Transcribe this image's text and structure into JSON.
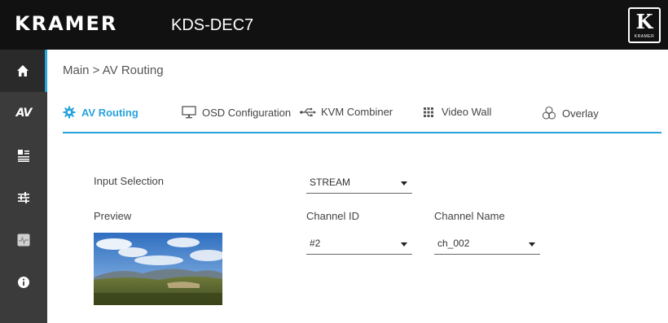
{
  "header": {
    "brand": "KRAMER",
    "model": "KDS-DEC7",
    "logo_letter": "K",
    "logo_sub": "KRAMER"
  },
  "sidebar": {
    "items": [
      {
        "icon": "home-icon",
        "active": true
      },
      {
        "icon": "av-icon",
        "label": "AV"
      },
      {
        "icon": "device-settings-icon"
      },
      {
        "icon": "sliders-icon"
      },
      {
        "icon": "diagnostics-icon"
      },
      {
        "icon": "info-icon"
      }
    ]
  },
  "breadcrumb": "Main > AV Routing",
  "tabs": [
    {
      "label": "AV Routing",
      "icon": "gear-icon",
      "active": true
    },
    {
      "label": "OSD Configuration",
      "icon": "monitor-icon"
    },
    {
      "label": "KVM Combiner",
      "icon": "usb-icon"
    },
    {
      "label": "Video Wall",
      "icon": "grid-icon"
    },
    {
      "label": "Overlay",
      "icon": "overlay-icon"
    }
  ],
  "form": {
    "input_selection_label": "Input Selection",
    "input_selection_value": "STREAM",
    "preview_label": "Preview",
    "channel_id_label": "Channel ID",
    "channel_id_value": "#2",
    "channel_name_label": "Channel Name",
    "channel_name_value": "ch_002"
  },
  "colors": {
    "accent": "#27a3dd",
    "topbar": "#111111",
    "sidebar": "#3b3b3b"
  }
}
